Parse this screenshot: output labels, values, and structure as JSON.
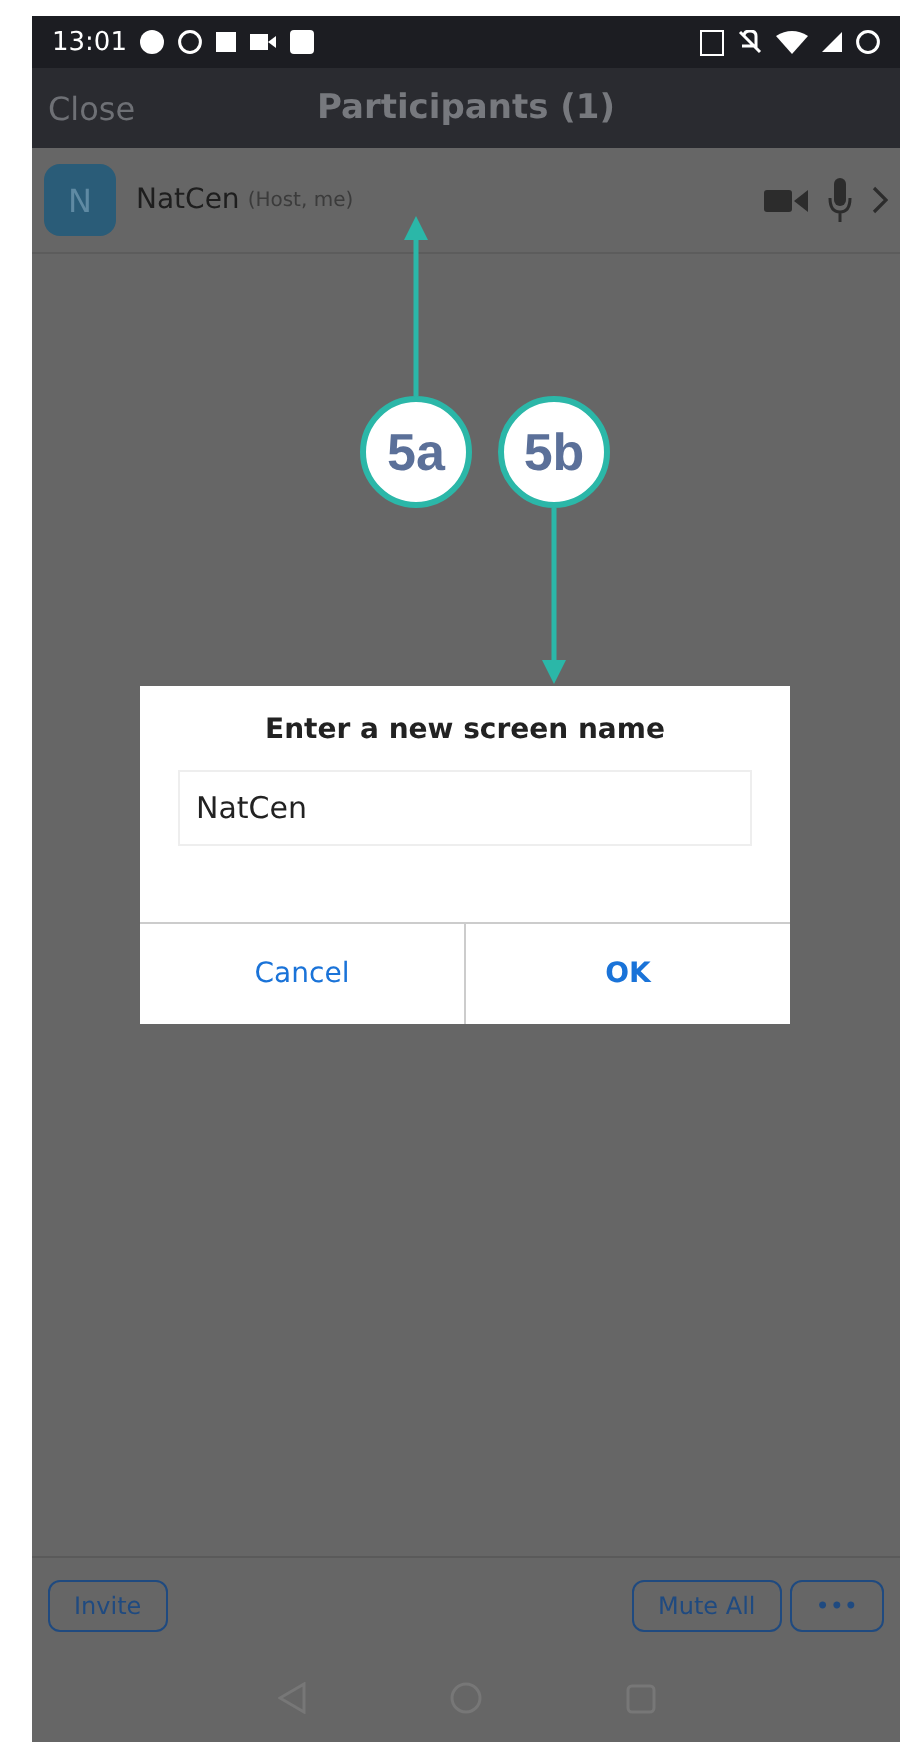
{
  "status_bar": {
    "time": "13:01"
  },
  "header": {
    "close": "Close",
    "title": "Participants (1)"
  },
  "participants": [
    {
      "initial": "N",
      "name": "NatCen",
      "role": "(Host, me)"
    }
  ],
  "annotations": [
    {
      "label": "5a",
      "kind": "up"
    },
    {
      "label": "5b",
      "kind": "down"
    }
  ],
  "dialog": {
    "title": "Enter a new screen name",
    "value": "NatCen",
    "buttons": [
      {
        "label": "Cancel",
        "primary": false
      },
      {
        "label": "OK",
        "primary": true
      }
    ]
  },
  "footer": {
    "left": [
      "Invite"
    ],
    "right": [
      "Mute All",
      "•••"
    ]
  }
}
